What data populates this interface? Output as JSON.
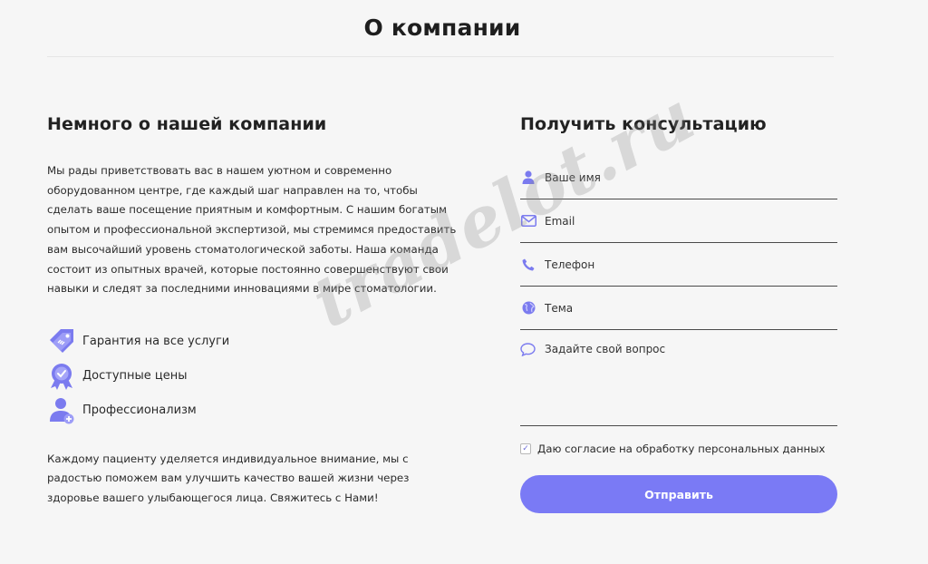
{
  "page": {
    "title": "О компании"
  },
  "about": {
    "heading": "Немного о нашей компании",
    "text": "Мы рады приветствовать вас в нашем уютном и современно оборудованном центре, где каждый шаг направлен на то, чтобы сделать ваше посещение приятным и комфортным. С нашим богатым опытом и профессиональной экспертизой, мы стремимся предоставить вам высочайший уровень стоматологической заботы. Наша команда состоит из опытных врачей, которые постоянно совершенствуют свои навыки и следят за последними инновациями в мире стоматологии.",
    "features": [
      {
        "icon": "price-tag-icon",
        "label": "Гарантия на все услуги"
      },
      {
        "icon": "badge-check-icon",
        "label": "Доступные цены"
      },
      {
        "icon": "user-plus-icon",
        "label": "Профессионализм"
      }
    ],
    "closing": "Каждому пациенту уделяется индивидуальное внимание, мы с радостью поможем вам улучшить качество вашей жизни через здоровье вашего улыбающегося лица. Свяжитесь с Нами!"
  },
  "form": {
    "heading": "Получить консультацию",
    "name_placeholder": "Ваше имя",
    "email_placeholder": "Email",
    "phone_placeholder": "Телефон",
    "topic_placeholder": "Тема",
    "question_placeholder": "Задайте свой вопрос",
    "consent_label": "Даю согласие на обработку персональных данных",
    "consent_checked": true,
    "submit_label": "Отправить"
  },
  "watermark": "tradelot.ru",
  "colors": {
    "accent": "#7a7af5",
    "icon": "#7b7bef",
    "background": "#f6f6f6"
  }
}
